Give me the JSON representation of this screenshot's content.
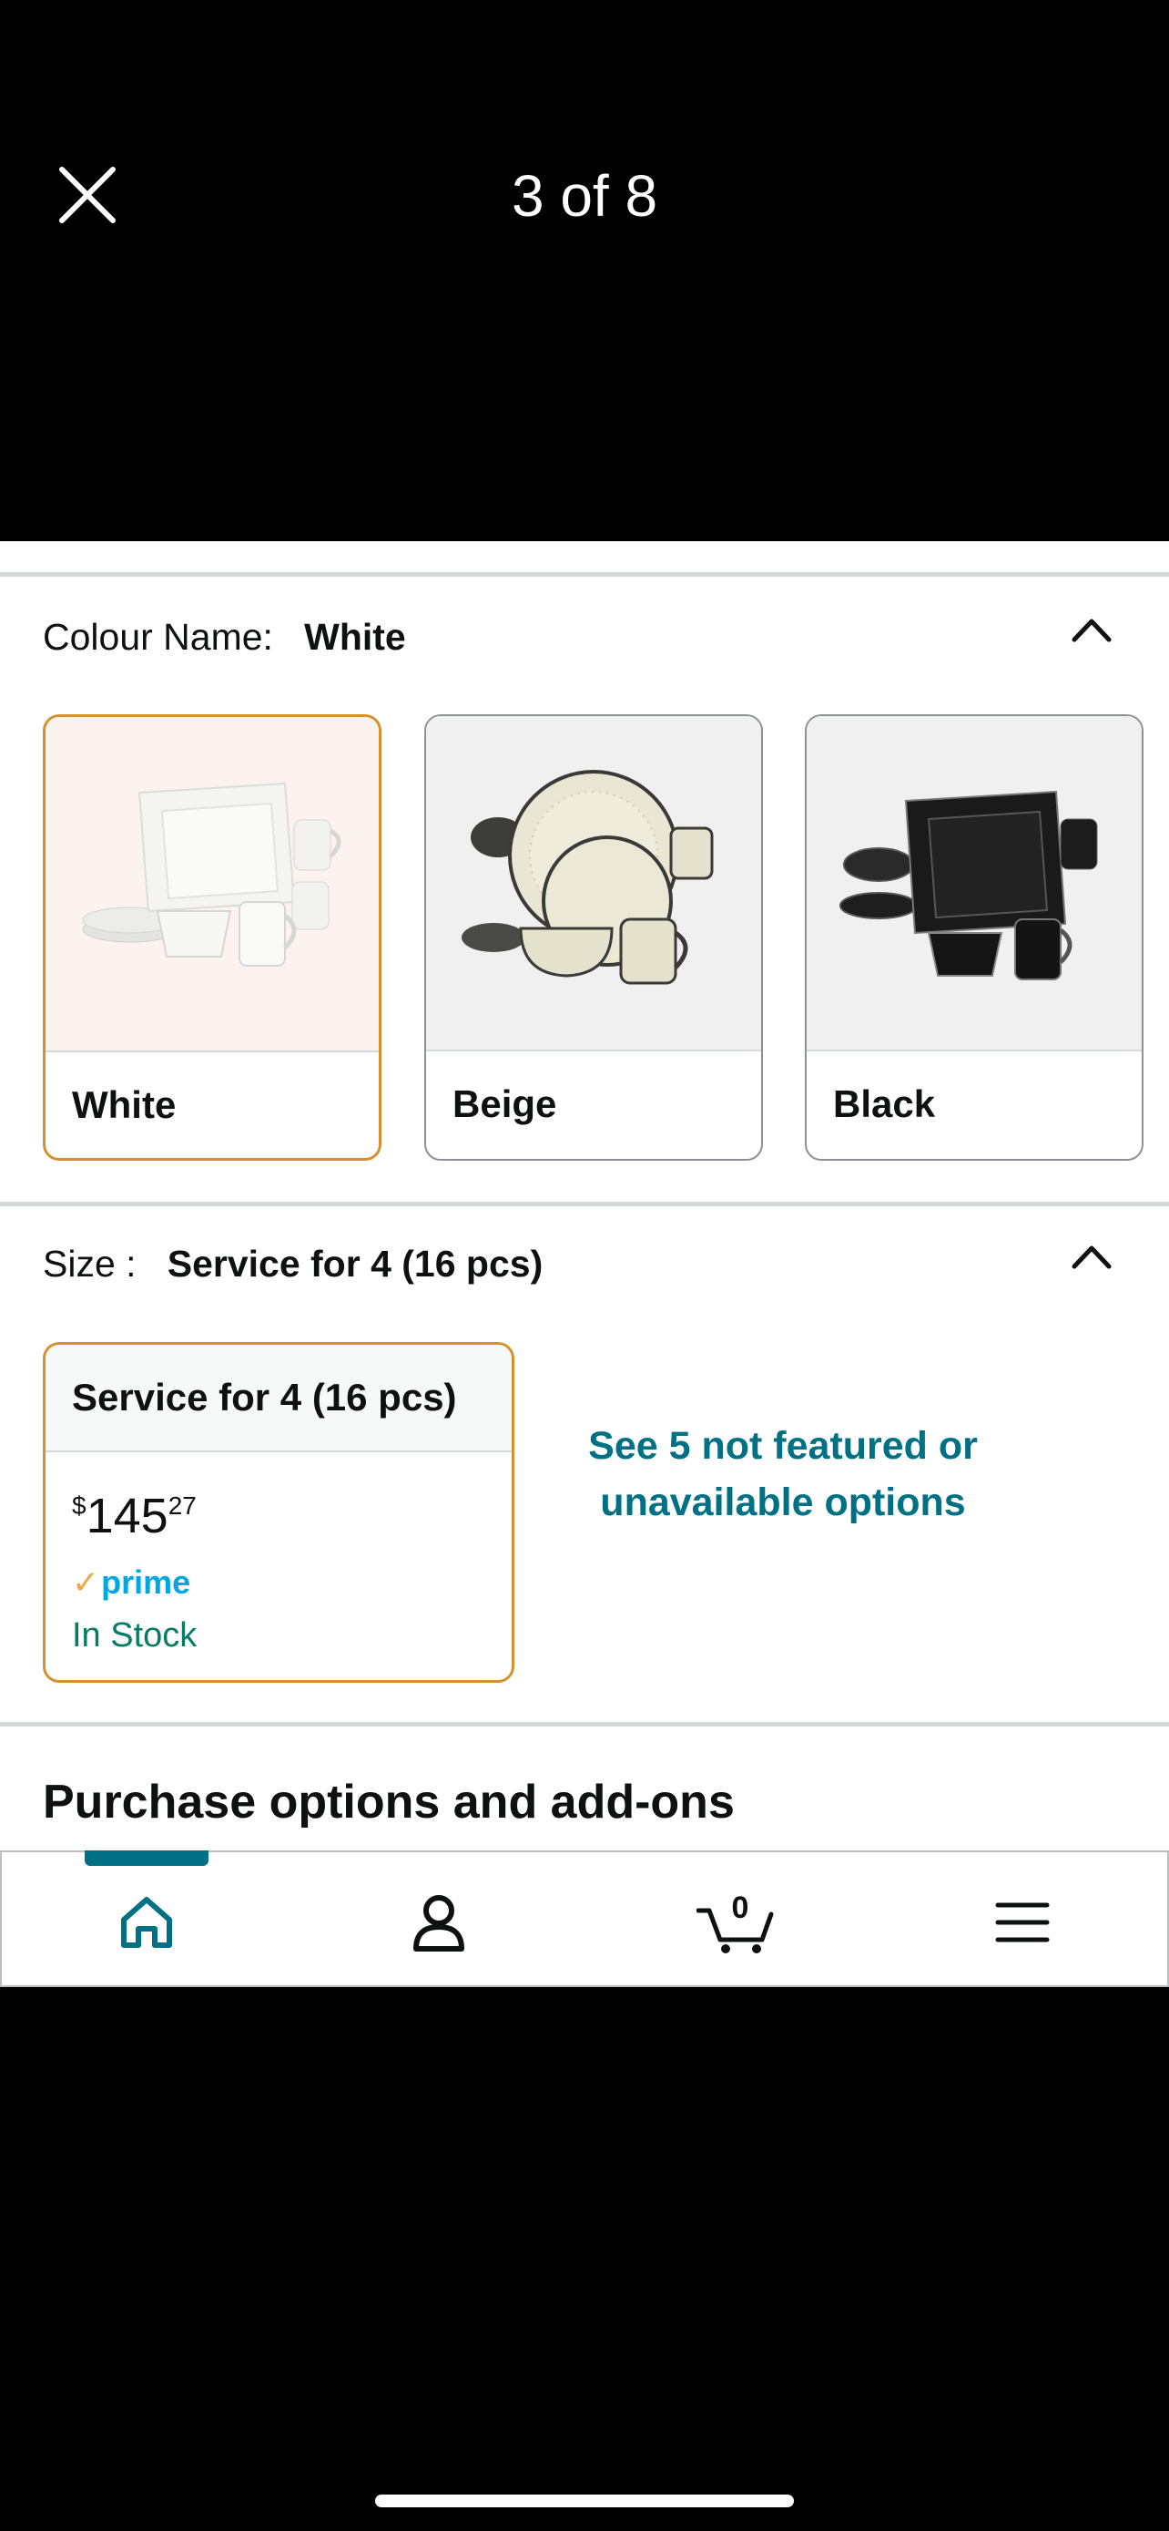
{
  "viewer": {
    "counter": "3 of 8"
  },
  "colour": {
    "label": "Colour Name:",
    "selected": "White",
    "options": [
      {
        "name": "White"
      },
      {
        "name": "Beige"
      },
      {
        "name": "Black"
      }
    ]
  },
  "size": {
    "label": "Size :",
    "selected": "Service for 4 (16 pcs)",
    "card": {
      "title": "Service for 4 (16 pcs)",
      "price_currency": "$",
      "price_whole": "145",
      "price_fraction": "27",
      "prime_label": "prime",
      "availability": "In Stock"
    },
    "more_options": "See 5 not featured or unavailable options"
  },
  "purchase_options_title": "Purchase options and add-ons",
  "cart_count": "0",
  "colors": {
    "accent": "#007185",
    "selected_border": "#d6912e",
    "in_stock": "#067d62",
    "prime": "#00a8e1"
  },
  "nav": {
    "icons": [
      "home-icon",
      "account-icon",
      "cart-icon",
      "menu-icon"
    ]
  }
}
